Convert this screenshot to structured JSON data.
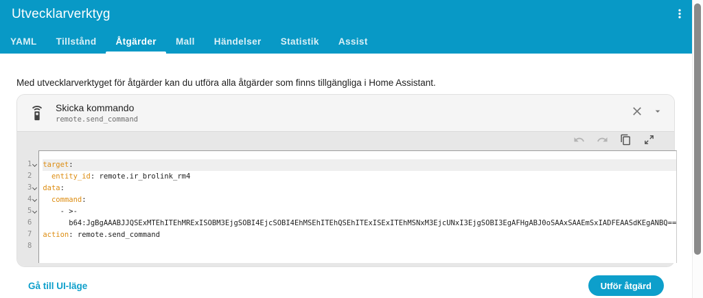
{
  "app": {
    "title": "Utvecklarverktyg"
  },
  "tabs": {
    "items": [
      {
        "label": "YAML",
        "active": false
      },
      {
        "label": "Tillstånd",
        "active": false
      },
      {
        "label": "Åtgärder",
        "active": true
      },
      {
        "label": "Mall",
        "active": false
      },
      {
        "label": "Händelser",
        "active": false
      },
      {
        "label": "Statistik",
        "active": false
      },
      {
        "label": "Assist",
        "active": false
      }
    ]
  },
  "intro": "Med utvecklarverktyget för åtgärder kan du utföra alla åtgärder som finns tillgängliga i Home Assistant.",
  "service_card": {
    "title": "Skicka kommando",
    "service_id": "remote.send_command",
    "icons": {
      "header_icon": "remote-icon",
      "close": "close-icon",
      "collapse": "chevron-down-icon",
      "toolbar": [
        "undo-icon",
        "redo-icon",
        "copy-icon",
        "fullscreen-expand-icon"
      ]
    }
  },
  "editor": {
    "lines": [
      {
        "num": "1",
        "fold": true,
        "active": true,
        "segments": [
          {
            "text": "target",
            "type": "key"
          },
          {
            "text": ":",
            "type": "plain"
          }
        ]
      },
      {
        "num": "2",
        "fold": false,
        "active": false,
        "segments": [
          {
            "text": "  ",
            "type": "plain"
          },
          {
            "text": "entity_id",
            "type": "key"
          },
          {
            "text": ": remote.ir_brolink_rm4",
            "type": "plain"
          }
        ]
      },
      {
        "num": "3",
        "fold": true,
        "active": false,
        "segments": [
          {
            "text": "data",
            "type": "key"
          },
          {
            "text": ":",
            "type": "plain"
          }
        ]
      },
      {
        "num": "4",
        "fold": true,
        "active": false,
        "segments": [
          {
            "text": "  ",
            "type": "plain"
          },
          {
            "text": "command",
            "type": "key"
          },
          {
            "text": ":",
            "type": "plain"
          }
        ]
      },
      {
        "num": "5",
        "fold": true,
        "active": false,
        "segments": [
          {
            "text": "    - >-",
            "type": "plain"
          }
        ]
      },
      {
        "num": "6",
        "fold": false,
        "active": false,
        "segments": [
          {
            "text": "      b64:JgBgAAABJJQSExMTEhITEhMRExISOBM3EjgSOBI4EjcSOBI4EhMSEhITEhQSEhITExISExITEhMSNxM3EjcUNxI3EjgSOBI3EgAFHgABJ0oSAAxSAAEmSxIADFEAASdKEgANBQ==",
            "type": "plain"
          }
        ]
      },
      {
        "num": "7",
        "fold": false,
        "active": false,
        "segments": [
          {
            "text": "action",
            "type": "key"
          },
          {
            "text": ": remote.send_command",
            "type": "plain"
          }
        ]
      },
      {
        "num": "8",
        "fold": false,
        "active": false,
        "segments": []
      }
    ]
  },
  "actions": {
    "link": "Gå till UI-läge",
    "button": "Utför åtgärd"
  },
  "colors": {
    "header": "#0899c6",
    "primary": "#0d9fcb",
    "key": "#dd8d12"
  }
}
